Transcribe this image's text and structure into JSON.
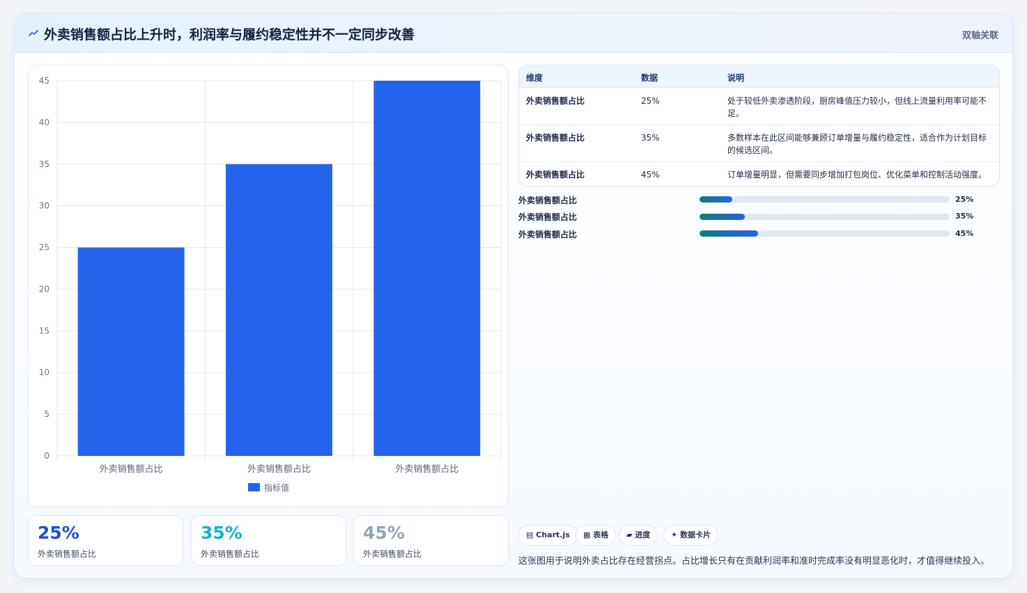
{
  "header": {
    "title": "外卖销售额占比上升时，利润率与履约稳定性并不一定同步改善",
    "tag": "双轴关联",
    "icon": "trend-line-icon"
  },
  "chart_data": {
    "type": "bar",
    "categories": [
      "外卖销售额占比",
      "外卖销售额占比",
      "外卖销售额占比"
    ],
    "series": [
      {
        "name": "指标值",
        "values": [
          25,
          35,
          45
        ],
        "color": "#2563eb"
      }
    ],
    "yticks": [
      0,
      5,
      10,
      15,
      20,
      25,
      30,
      35,
      40,
      45
    ],
    "ylim": [
      0,
      45
    ],
    "grid": true,
    "legend_position": "bottom"
  },
  "stats": [
    {
      "value": "25%",
      "label": "外卖销售额占比",
      "color": "#1d4fd8"
    },
    {
      "value": "35%",
      "label": "外卖销售额占比",
      "color": "#14b3c6"
    },
    {
      "value": "45%",
      "label": "外卖销售额占比",
      "color": "#94a3b8"
    }
  ],
  "table": {
    "headers": [
      "维度",
      "数据",
      "说明"
    ],
    "rows": [
      {
        "dimension": "外卖销售额占比",
        "value": "25%",
        "note": "处于较低外卖渗透阶段，厨房峰值压力较小，但线上流量利用率可能不足。"
      },
      {
        "dimension": "外卖销售额占比",
        "value": "35%",
        "note": "多数样本在此区间能够兼顾订单增量与履约稳定性，适合作为计划目标的候选区间。"
      },
      {
        "dimension": "外卖销售额占比",
        "value": "45%",
        "note": "订单增量明显，但需要同步增加打包岗位、优化菜单和控制活动强度。"
      }
    ]
  },
  "progress": [
    {
      "label": "外卖销售额占比",
      "value_text": "25%",
      "fraction": 0.13
    },
    {
      "label": "外卖销售额占比",
      "value_text": "35%",
      "fraction": 0.18
    },
    {
      "label": "外卖销售额占比",
      "value_text": "45%",
      "fraction": 0.235
    }
  ],
  "chips": [
    {
      "glyph": "▤",
      "label": "Chart.js"
    },
    {
      "glyph": "▦",
      "label": "表格"
    },
    {
      "glyph": "▰",
      "label": "进度"
    },
    {
      "glyph": "✦",
      "label": "数据卡片"
    }
  ],
  "footnote": "这张图用于说明外卖占比存在经营拐点。占比增长只有在贡献利润率和准时完成率没有明显恶化时，才值得继续投入。"
}
